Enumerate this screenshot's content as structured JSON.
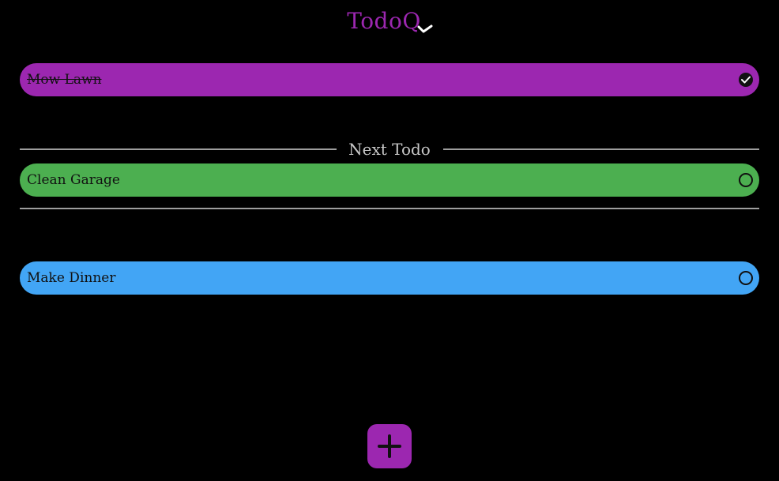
{
  "app": {
    "title": "TodoQ",
    "logo_text": "Todo",
    "logo_q": "Q",
    "accent_color": "#9c27b0"
  },
  "next_section": {
    "label": "Next Todo",
    "line_color": "#9e9e9e"
  },
  "todos": [
    {
      "label": "Mow Lawn",
      "completed": true,
      "color": "#9c27b0",
      "status_icon": "check-circle-icon"
    },
    {
      "label": "Clean Garage",
      "completed": false,
      "color": "#4caf50",
      "status_icon": "empty-circle-icon"
    },
    {
      "label": "Make Dinner",
      "completed": false,
      "color": "#42a5f5",
      "status_icon": "empty-circle-icon"
    }
  ],
  "add_button": {
    "icon": "plus-icon",
    "color": "#9c27b0"
  }
}
